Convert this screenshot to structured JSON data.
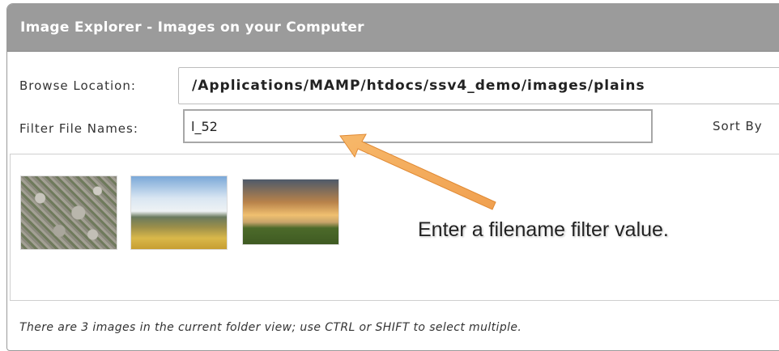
{
  "window": {
    "title": "Image Explorer - Images on your Computer"
  },
  "browse": {
    "label": "Browse Location:",
    "path": "/Applications/MAMP/htdocs/ssv4_demo/images/plains"
  },
  "filter": {
    "label": "Filter File Names:",
    "value": "l_52"
  },
  "sort": {
    "label": "Sort By"
  },
  "gallery": {
    "thumbnails": [
      "rocky-field-image",
      "plains-blue-sky-image",
      "plains-sunset-image"
    ]
  },
  "callout": {
    "text": "Enter a filename filter value.",
    "arrow_color": "#f0a050"
  },
  "status": {
    "text": "There are 3 images in the current folder view; use CTRL or SHIFT to select multiple."
  },
  "colors": {
    "titlebar": "#9b9b9b",
    "title_text": "#ffffff"
  }
}
